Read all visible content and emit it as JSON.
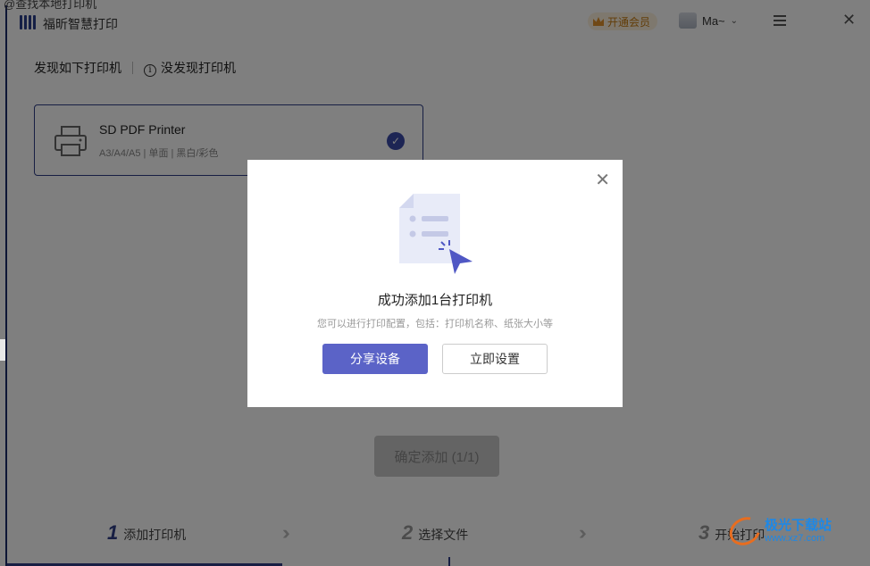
{
  "window": {
    "title": "福昕智慧打印",
    "top_snippet": "@查找本地打印机",
    "vip_label": "开通会员",
    "user_name": "Ma~"
  },
  "tabs": [
    {
      "label": "发现如下打印机"
    },
    {
      "label": "没发现打印机"
    }
  ],
  "printer": {
    "name": "SD PDF Printer",
    "spec": "A3/A4/A5 | 单面 | 黑白/彩色"
  },
  "confirm_label": "确定添加 (1/1)",
  "steps": [
    {
      "num": "1",
      "label": "添加打印机"
    },
    {
      "num": "2",
      "label": "选择文件"
    },
    {
      "num": "3",
      "label": "开始打印"
    }
  ],
  "modal": {
    "title": "成功添加1台打印机",
    "subtitle": "您可以进行打印配置，包括：打印机名称、纸张大小等",
    "primary_label": "分享设备",
    "secondary_label": "立即设置"
  },
  "watermark": {
    "text": "极光下载站",
    "url": "www.xz7.com"
  },
  "colors": {
    "accent": "#2e3d86",
    "primary_button": "#5b63c7",
    "vip": "#c57a10"
  }
}
